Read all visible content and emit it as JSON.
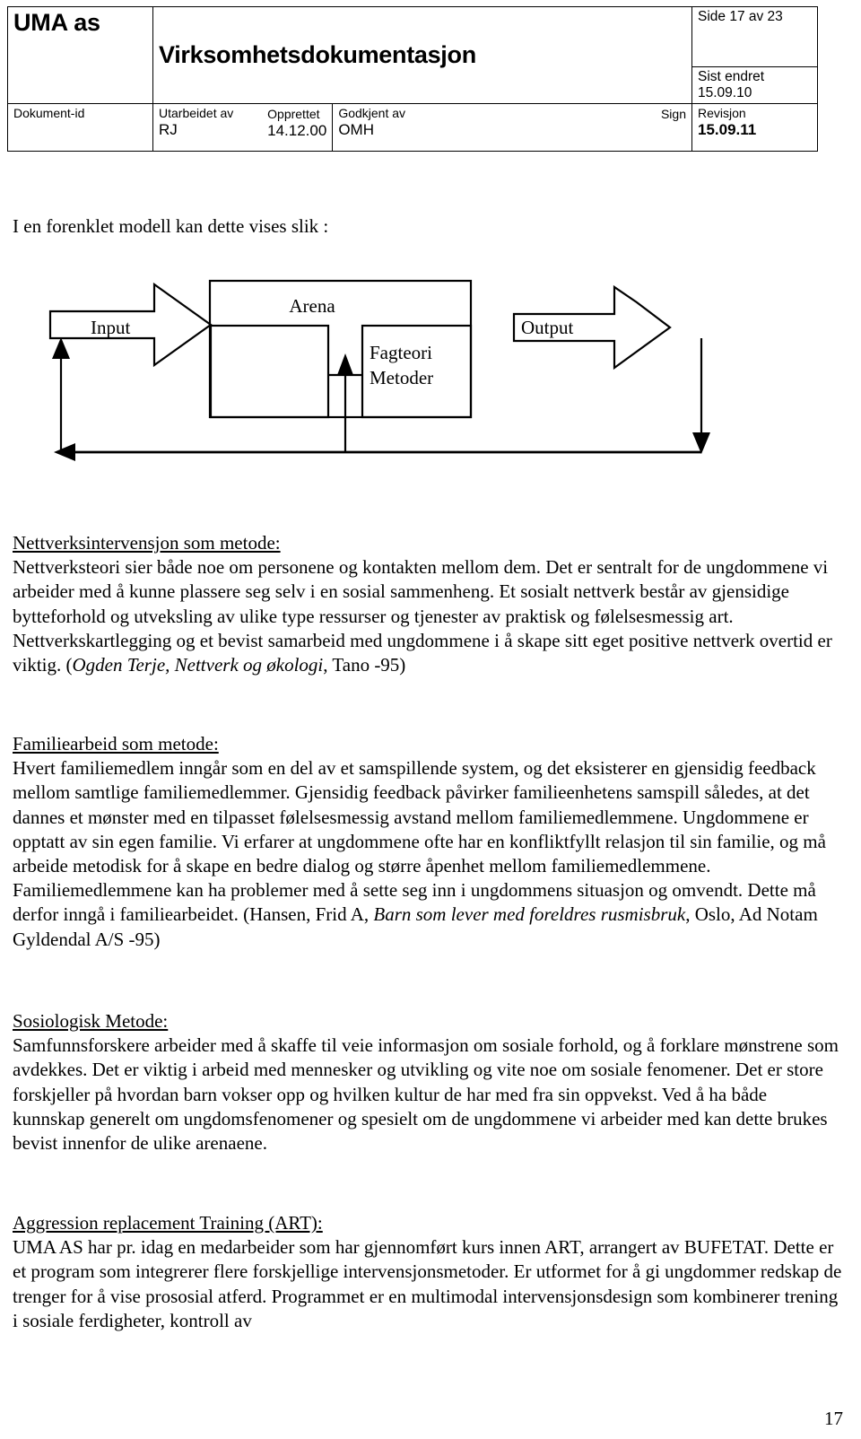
{
  "header": {
    "logo": "UMA as",
    "title": "Virksomhetsdokumentasjon",
    "side_label": "Side 17 av 23",
    "sist_endret_label": "Sist  endret",
    "sist_endret_value": "15.09.10",
    "dokument_id_label": "Dokument-id",
    "utarbeidet_label": "Utarbeidet av",
    "utarbeidet_value": "RJ",
    "opprettet_label": "Opprettet",
    "opprettet_value": "14.12.00",
    "godkjent_label": "Godkjent av",
    "godkjent_value": "OMH",
    "sign_label": "Sign",
    "revisjon_label": "Revisjon",
    "revisjon_value": "15.09.11"
  },
  "intro": "I en forenklet modell kan dette vises slik :",
  "diagram": {
    "input_label": "Input",
    "arena_label": "Arena",
    "fagteori_label": "Fagteori",
    "metoder_label": "Metoder",
    "output_label": "Output"
  },
  "sections": [
    {
      "heading": "Nettverksintervensjon som metode:",
      "paragraph_pre": "Nettverksteori sier både noe om personene og kontakten mellom dem. Det er sentralt for de ungdommene vi arbeider med å kunne plassere seg selv i en sosial sammenheng. Et sosialt nettverk består av gjensidige bytteforhold og utveksling av ulike type ressurser og tjenester av praktisk og følelsesmessig art. Nettverkskartlegging og et bevist samarbeid med ungdommene i å skape sitt eget positive nettverk overtid er viktig. (",
      "paragraph_italic": "Ogden Terje,  Nettverk og økologi",
      "paragraph_post": ", Tano -95)"
    },
    {
      "heading": "Familiearbeid som metode:",
      "paragraph_pre": "Hvert familiemedlem inngår som en del av et samspillende system, og det eksisterer en gjensidig feedback mellom samtlige familiemedlemmer. Gjensidig feedback påvirker familieenhetens samspill således, at det dannes et mønster med en tilpasset følelsesmessig avstand mellom familiemedlemmene. Ungdommene er opptatt av sin egen familie.  Vi erfarer at ungdommene ofte har en konfliktfyllt relasjon til sin familie, og må arbeide metodisk for å skape en bedre dialog og større åpenhet mellom familiemedlemmene. Familiemedlemmene kan ha problemer med å sette seg inn i ungdommens situasjon og omvendt. Dette må derfor inngå i familiearbeidet. (Hansen, Frid A, ",
      "paragraph_italic": "Barn som lever med foreldres rusmisbruk",
      "paragraph_post": ", Oslo, Ad Notam Gyldendal A/S -95)"
    },
    {
      "heading": "Sosiologisk Metode:",
      "paragraph_pre": "Samfunnsforskere arbeider med å skaffe til veie informasjon om sosiale forhold, og å forklare mønstrene som avdekkes. Det er viktig i arbeid med mennesker og utvikling og vite noe om sosiale fenomener. Det er store forskjeller på hvordan barn vokser opp og hvilken kultur de har med fra sin oppvekst. Ved å ha både kunnskap generelt om ungdomsfenomener og spesielt om de ungdommene vi arbeider med kan dette brukes bevist innenfor de ulike arenaene.",
      "paragraph_italic": "",
      "paragraph_post": ""
    },
    {
      "heading": "Aggression replacement Training (ART):",
      "paragraph_pre": "UMA AS har pr. idag en medarbeider som har gjennomført kurs innen ART, arrangert av BUFETAT. Dette er et program som integrerer flere forskjellige intervensjonsmetoder. Er utformet for å gi ungdommer redskap de trenger for å vise prososial atferd. Programmet er en multimodal intervensjonsdesign som kombinerer trening i sosiale ferdigheter, kontroll av",
      "paragraph_italic": "",
      "paragraph_post": ""
    }
  ],
  "page_number": "17"
}
